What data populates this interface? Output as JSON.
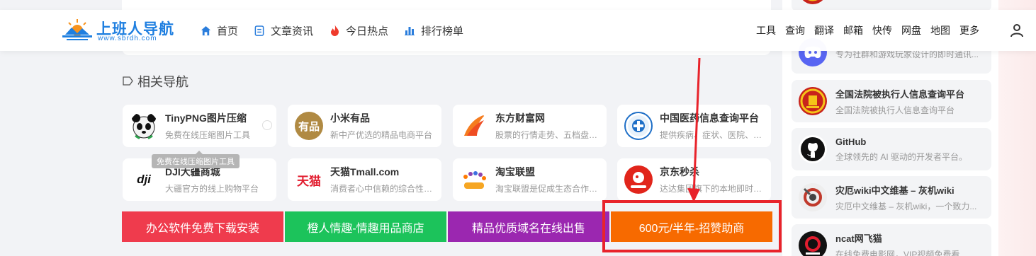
{
  "header": {
    "logo_title": "上班人导航",
    "logo_sub": "www.sbrdh.com",
    "nav": [
      {
        "label": "首页",
        "icon": "home-icon"
      },
      {
        "label": "文章资讯",
        "icon": "document-icon"
      },
      {
        "label": "今日热点",
        "icon": "flame-icon"
      },
      {
        "label": "排行榜单",
        "icon": "ranking-icon"
      }
    ],
    "right_links": [
      "工具",
      "查询",
      "翻译",
      "邮箱",
      "快传",
      "网盘",
      "地图",
      "更多"
    ]
  },
  "section": {
    "title": "相关导航"
  },
  "cards": [
    {
      "title": "TinyPNG图片压缩",
      "desc": "免费在线压缩图片工具",
      "icon": "panda-icon"
    },
    {
      "title": "小米有品",
      "desc": "新中产优选的精品电商平台",
      "icon": "youpin-icon",
      "icon_text": "有品"
    },
    {
      "title": "东方财富网",
      "desc": "股票的行情走势、五档盘口、资金流向...",
      "icon": "eastmoney-icon"
    },
    {
      "title": "中国医药信息查询平台",
      "desc": "提供疾病、症状、医院、药品信息查询",
      "icon": "medical-icon"
    },
    {
      "title": "DJI大疆商城",
      "desc": "大疆官方的线上购物平台",
      "icon": "dji-icon",
      "icon_text": "dji"
    },
    {
      "title": "天猫Tmall.com",
      "desc": "消费者心中信赖的综合性购物平台",
      "icon": "tmall-icon",
      "icon_text": "天猫"
    },
    {
      "title": "淘宝联盟",
      "desc": "淘宝联盟是促成生态合作伙伴的平台",
      "icon": "taobao-union-icon"
    },
    {
      "title": "京东秒杀",
      "desc": "达达集团旗下的本地即时零售平台",
      "icon": "jd-seckill-icon"
    }
  ],
  "tooltip": "免费在线压缩图片工具",
  "ads": [
    {
      "label": "办公软件免费下载安装",
      "color": "#ef3b4d"
    },
    {
      "label": "橙人情趣-情趣用品商店",
      "color": "#1cc35b"
    },
    {
      "label": "精品优质域名在线出售",
      "color": "#9b27b0"
    },
    {
      "label": "600元/半年-招赞助商",
      "color": "#f76a00"
    }
  ],
  "sidebar": [
    {
      "title": "",
      "desc": "",
      "icon": "emblem-icon"
    },
    {
      "title": "",
      "desc": "专为社群和游戏玩家设计的即时通讯...",
      "icon": "discord-icon"
    },
    {
      "title": "全国法院被执行人信息查询平台",
      "desc": "全国法院被执行人信息查询平台",
      "icon": "court-emblem-icon"
    },
    {
      "title": "GitHub",
      "desc": "全球领先的 AI 驱动的开发者平台。",
      "icon": "github-icon"
    },
    {
      "title": "灾厄wiki中文维基 – 灰机wiki",
      "desc": "灾厄中文维基 – 灰机wiki，一个致力...",
      "icon": "wiki-icon"
    },
    {
      "title": "ncat网飞猫",
      "desc": "在线免费电影网，VIP视频免费看",
      "icon": "ncat-icon"
    }
  ],
  "highlight_color": "#e8232b"
}
